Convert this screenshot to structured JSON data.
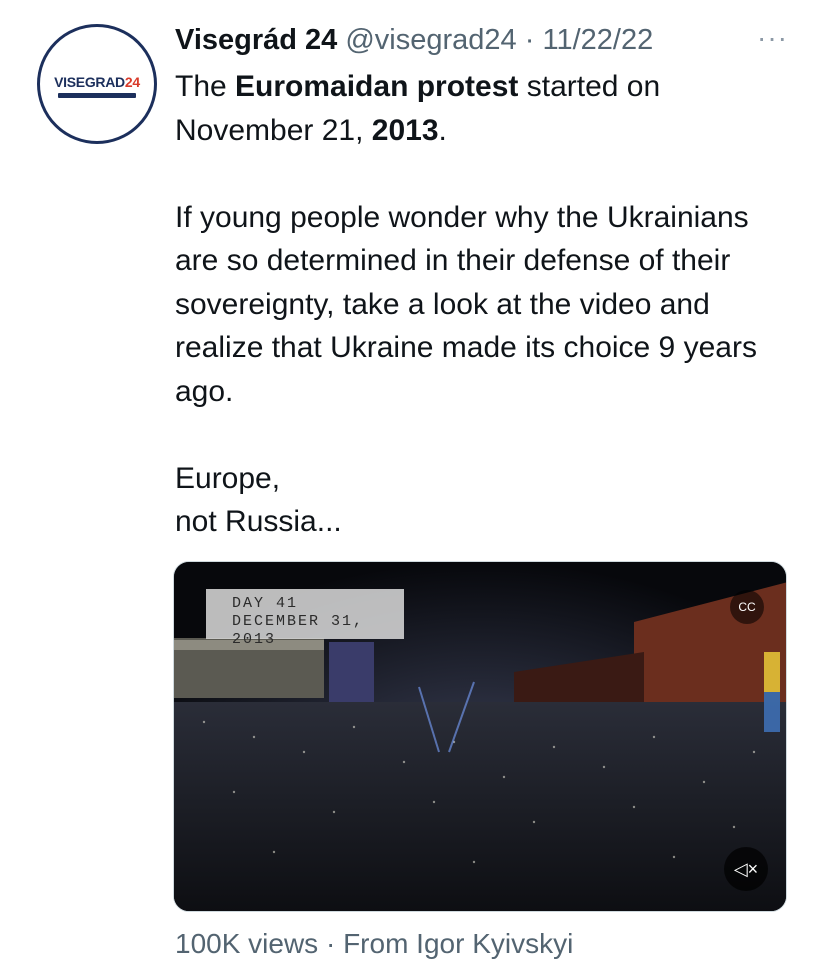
{
  "author": {
    "name": "Visegrád 24",
    "handle": "@visegrad24",
    "separator": "·",
    "date": "11/22/22",
    "more": "···",
    "avatar_logo": {
      "main": "VISEGRAD",
      "number": "24"
    }
  },
  "tweet": {
    "line1_prefix": "The ",
    "line1_bold": "Euromaidan protest",
    "line1_suffix": " started on",
    "line2_prefix": "November 21, ",
    "line2_bold": "2013",
    "line2_suffix": ".",
    "para2": "If young people wonder why the Ukrainians are so determined in their defense of their sovereignty, take a look at the video and realize that Ukraine made its choice 9 years ago.",
    "para3_line1": "Europe,",
    "para3_line2": "not Russia..."
  },
  "video": {
    "stamp_line1": "DAY 41",
    "stamp_line2": "DECEMBER 31, 2013",
    "cc_label": "CC",
    "mute_glyph": "◁×"
  },
  "footer": {
    "views": "100K views",
    "separator": " · ",
    "source": "From Igor Kyivskyi"
  },
  "colors": {
    "text": "#0f1419",
    "muted": "#536471",
    "logo_navy": "#1c2f5c",
    "logo_red": "#d93b2b"
  }
}
